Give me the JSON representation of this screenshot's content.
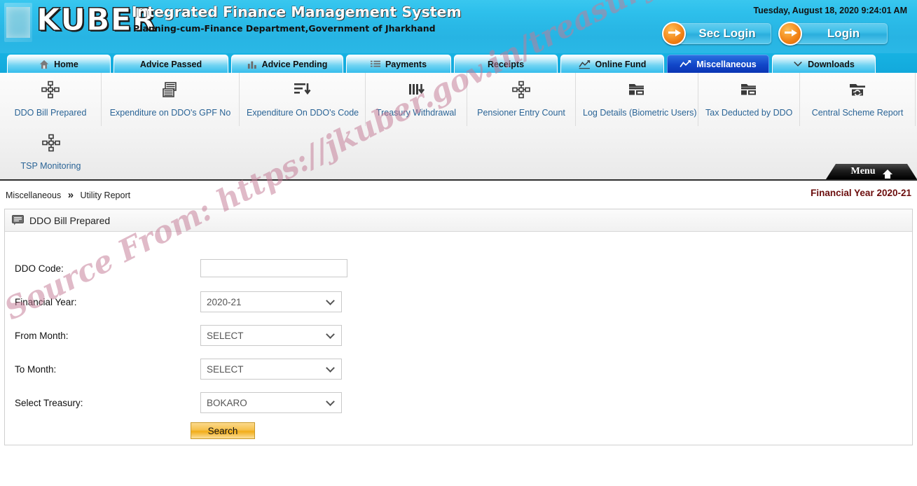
{
  "header": {
    "brand": "KUBER",
    "system_title": "Integrated Finance Management System",
    "system_subtitle": "Planning-cum-Finance Department,Government of Jharkhand",
    "datetime": "Tuesday, August 18, 2020 9:24:01 AM",
    "sec_login_label": "Sec Login",
    "login_label": "Login",
    "logo_icon": "kuber-logo"
  },
  "nav": {
    "tabs": [
      {
        "label": "Home",
        "icon": "home-icon",
        "active": false
      },
      {
        "label": "Advice Passed",
        "icon": "none",
        "active": false
      },
      {
        "label": "Advice Pending",
        "icon": "bar-chart-icon",
        "active": false
      },
      {
        "label": "Payments",
        "icon": "list-icon",
        "active": false
      },
      {
        "label": "Receipts",
        "icon": "none",
        "active": false
      },
      {
        "label": "Online Fund",
        "icon": "trend-line-icon",
        "active": false
      },
      {
        "label": "Miscellaneous",
        "icon": "trend-line-icon",
        "active": true
      },
      {
        "label": "Downloads",
        "icon": "download-icon",
        "active": false
      }
    ]
  },
  "submenu": {
    "row1": [
      {
        "label": "DDO Bill Prepared",
        "icon": "nodes-icon"
      },
      {
        "label": "Expenditure on DDO's GPF No",
        "icon": "stacked-pages-icon"
      },
      {
        "label": "Expenditure On DDO's Code",
        "icon": "sort-descending-icon"
      },
      {
        "label": "Treasury Withdrawal",
        "icon": "bars-download-icon"
      },
      {
        "label": "Pensioner Entry Count",
        "icon": "nodes-icon"
      },
      {
        "label": "Log Details (Biometric Users)",
        "icon": "folder-window-icon"
      },
      {
        "label": "Tax Deducted by DDO",
        "icon": "folder-window-icon"
      },
      {
        "label": "Central Scheme Report",
        "icon": "folder-refresh-icon"
      }
    ],
    "row2": [
      {
        "label": "TSP Monitoring",
        "icon": "nodes-icon"
      }
    ],
    "menu_tab_label": "Menu",
    "menu_tab_icon": "home-icon"
  },
  "breadcrumb": {
    "parent": "Miscellaneous",
    "separator": "»",
    "current": "Utility Report"
  },
  "financial_year_badge": "Financial Year 2020-21",
  "panel": {
    "title": "DDO Bill Prepared",
    "title_icon": "report-icon",
    "fields": [
      {
        "label": "DDO Code:",
        "type": "text",
        "value": "",
        "placeholder": "",
        "name": "ddo-code-input"
      },
      {
        "label": "Financial Year:",
        "type": "select",
        "value": "2020-21",
        "name": "financial-year-select"
      },
      {
        "label": "From Month:",
        "type": "select",
        "value": "SELECT",
        "name": "from-month-select"
      },
      {
        "label": "To Month:",
        "type": "select",
        "value": "SELECT",
        "name": "to-month-select"
      },
      {
        "label": "Select Treasury:",
        "type": "select",
        "value": "BOKARO",
        "name": "treasury-select"
      }
    ],
    "search_label": "Search"
  },
  "watermark": {
    "text": "Source From: https://jkuber.gov.in/treasurymis/rptUtility.aspx?id=ddp",
    "color": "#c47b96"
  },
  "colors": {
    "header_cyan": "#2ab8e6",
    "active_tab_blue": "#1146c8",
    "link_blue": "#2a6496",
    "fy_maroon": "#6b0d0d",
    "search_orange": "#f2ad18"
  }
}
